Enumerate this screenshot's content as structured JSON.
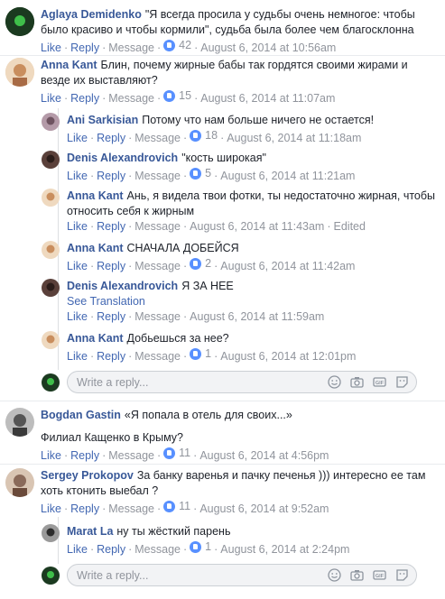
{
  "meta": {
    "like": "Like",
    "reply": "Reply",
    "message": "Message",
    "see_translation": "See Translation",
    "reply_placeholder": "Write a reply..."
  },
  "comments": [
    {
      "name": "Aglaya Demidenko",
      "text": "\"Я всегда просила у судьбы очень немногое: чтобы было красиво и чтобы кормили\", судьба была более чем благосклонна",
      "likes": "42",
      "date": "August 6, 2014 at 10:56am",
      "edited": "",
      "avatar_color": "#1e3a1e"
    },
    {
      "name": "Anna Kant",
      "text": "Блин, почему жирные бабы так гордятся своими жирами и везде их выставляют?",
      "likes": "15",
      "date": "August 6, 2014 at 11:07am",
      "edited": "",
      "avatar_color": "#d9b38c"
    },
    {
      "name": "Ani Sarkisian",
      "text": "Потому что нам больше ничего не остается!",
      "likes": "18",
      "date": "August 6, 2014 at 11:18am",
      "edited": "",
      "avatar_color": "#7a6a73"
    },
    {
      "name": "Denis Alexandrovich",
      "text": "\"кость широкая\"",
      "likes": "5",
      "date": "August 6, 2014 at 11:21am",
      "edited": "",
      "avatar_color": "#4a3630"
    },
    {
      "name": "Anna Kant",
      "text": "Ань, я видела твои фотки, ты недостаточно жирная, чтобы относить себя к жирным",
      "likes": "",
      "date": "August 6, 2014 at 11:43am",
      "edited": "Edited",
      "avatar_color": "#d9b38c"
    },
    {
      "name": "Anna Kant",
      "text": "СНАЧАЛА ДОБЕЙСЯ",
      "likes": "2",
      "date": "August 6, 2014 at 11:42am",
      "edited": "",
      "avatar_color": "#d9b38c"
    },
    {
      "name": "Denis Alexandrovich",
      "text": "Я ЗА НЕЕ",
      "likes": "",
      "date": "August 6, 2014 at 11:59am",
      "edited": "",
      "avatar_color": "#4a3630"
    },
    {
      "name": "Anna Kant",
      "text": "Добьешься за нее?",
      "likes": "1",
      "date": "August 6, 2014 at 12:01pm",
      "edited": "",
      "avatar_color": "#d9b38c"
    },
    {
      "name": "Bogdan Gastin",
      "text": "«Я попала в отель для своих...»",
      "text2": "Филиал Кащенко в Крыму?",
      "likes": "11",
      "date": "August 6, 2014 at 4:56pm",
      "edited": "",
      "avatar_color": "#6b6b6b"
    },
    {
      "name": "Sergey Prokopov",
      "text": "За банку варенья и пачку печенья ))) интересно ее там хоть ктонить выебал ?",
      "likes": "11",
      "date": "August 6, 2014 at 9:52am",
      "edited": "",
      "avatar_color": "#8a6a5a"
    },
    {
      "name": "Marat La",
      "text": "ну ты жёсткий парень",
      "likes": "1",
      "date": "August 6, 2014 at 2:24pm",
      "edited": "",
      "avatar_color": "#2c2c2c"
    }
  ]
}
